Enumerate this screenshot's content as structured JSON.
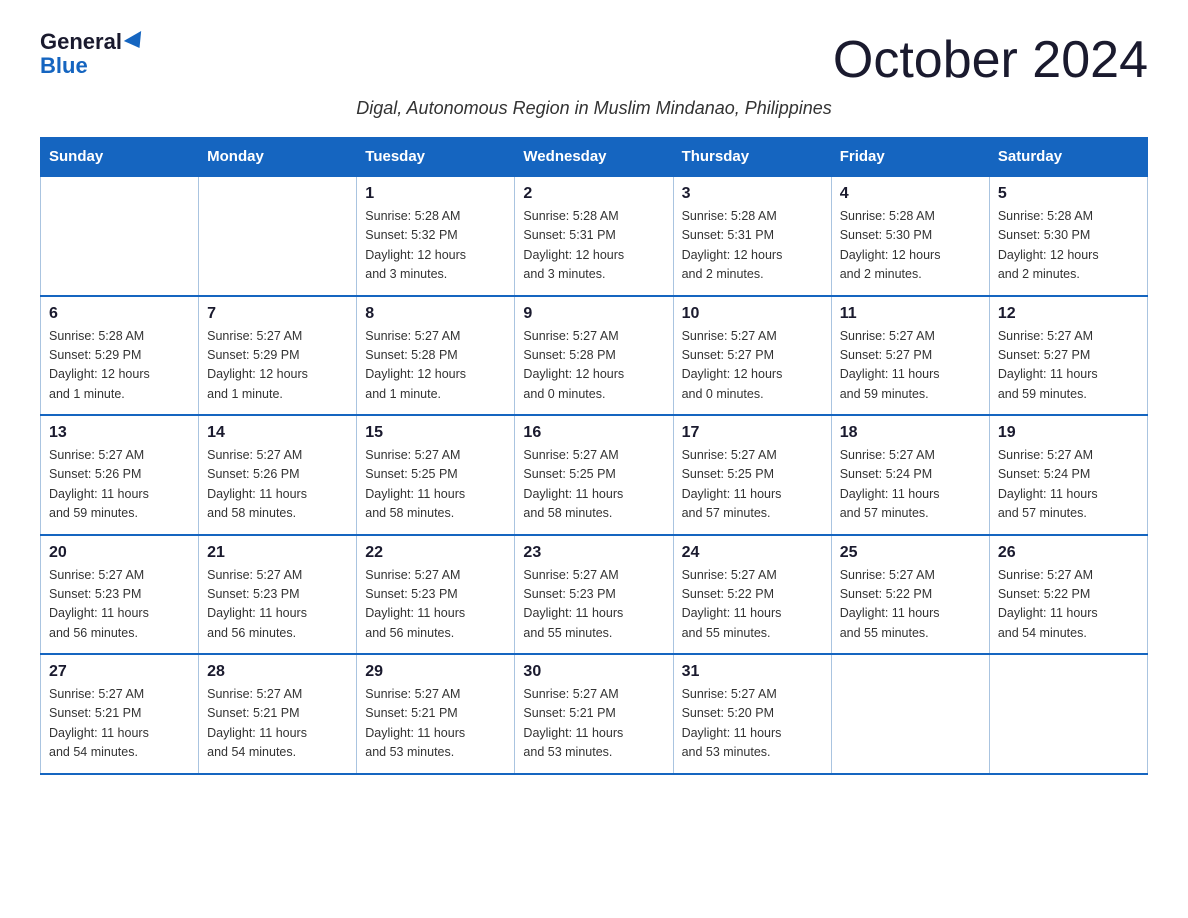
{
  "header": {
    "logo_general": "General",
    "logo_blue": "Blue",
    "month_title": "October 2024",
    "location": "Digal, Autonomous Region in Muslim Mindanao, Philippines"
  },
  "weekdays": [
    "Sunday",
    "Monday",
    "Tuesday",
    "Wednesday",
    "Thursday",
    "Friday",
    "Saturday"
  ],
  "weeks": [
    [
      {
        "day": "",
        "info": ""
      },
      {
        "day": "",
        "info": ""
      },
      {
        "day": "1",
        "info": "Sunrise: 5:28 AM\nSunset: 5:32 PM\nDaylight: 12 hours\nand 3 minutes."
      },
      {
        "day": "2",
        "info": "Sunrise: 5:28 AM\nSunset: 5:31 PM\nDaylight: 12 hours\nand 3 minutes."
      },
      {
        "day": "3",
        "info": "Sunrise: 5:28 AM\nSunset: 5:31 PM\nDaylight: 12 hours\nand 2 minutes."
      },
      {
        "day": "4",
        "info": "Sunrise: 5:28 AM\nSunset: 5:30 PM\nDaylight: 12 hours\nand 2 minutes."
      },
      {
        "day": "5",
        "info": "Sunrise: 5:28 AM\nSunset: 5:30 PM\nDaylight: 12 hours\nand 2 minutes."
      }
    ],
    [
      {
        "day": "6",
        "info": "Sunrise: 5:28 AM\nSunset: 5:29 PM\nDaylight: 12 hours\nand 1 minute."
      },
      {
        "day": "7",
        "info": "Sunrise: 5:27 AM\nSunset: 5:29 PM\nDaylight: 12 hours\nand 1 minute."
      },
      {
        "day": "8",
        "info": "Sunrise: 5:27 AM\nSunset: 5:28 PM\nDaylight: 12 hours\nand 1 minute."
      },
      {
        "day": "9",
        "info": "Sunrise: 5:27 AM\nSunset: 5:28 PM\nDaylight: 12 hours\nand 0 minutes."
      },
      {
        "day": "10",
        "info": "Sunrise: 5:27 AM\nSunset: 5:27 PM\nDaylight: 12 hours\nand 0 minutes."
      },
      {
        "day": "11",
        "info": "Sunrise: 5:27 AM\nSunset: 5:27 PM\nDaylight: 11 hours\nand 59 minutes."
      },
      {
        "day": "12",
        "info": "Sunrise: 5:27 AM\nSunset: 5:27 PM\nDaylight: 11 hours\nand 59 minutes."
      }
    ],
    [
      {
        "day": "13",
        "info": "Sunrise: 5:27 AM\nSunset: 5:26 PM\nDaylight: 11 hours\nand 59 minutes."
      },
      {
        "day": "14",
        "info": "Sunrise: 5:27 AM\nSunset: 5:26 PM\nDaylight: 11 hours\nand 58 minutes."
      },
      {
        "day": "15",
        "info": "Sunrise: 5:27 AM\nSunset: 5:25 PM\nDaylight: 11 hours\nand 58 minutes."
      },
      {
        "day": "16",
        "info": "Sunrise: 5:27 AM\nSunset: 5:25 PM\nDaylight: 11 hours\nand 58 minutes."
      },
      {
        "day": "17",
        "info": "Sunrise: 5:27 AM\nSunset: 5:25 PM\nDaylight: 11 hours\nand 57 minutes."
      },
      {
        "day": "18",
        "info": "Sunrise: 5:27 AM\nSunset: 5:24 PM\nDaylight: 11 hours\nand 57 minutes."
      },
      {
        "day": "19",
        "info": "Sunrise: 5:27 AM\nSunset: 5:24 PM\nDaylight: 11 hours\nand 57 minutes."
      }
    ],
    [
      {
        "day": "20",
        "info": "Sunrise: 5:27 AM\nSunset: 5:23 PM\nDaylight: 11 hours\nand 56 minutes."
      },
      {
        "day": "21",
        "info": "Sunrise: 5:27 AM\nSunset: 5:23 PM\nDaylight: 11 hours\nand 56 minutes."
      },
      {
        "day": "22",
        "info": "Sunrise: 5:27 AM\nSunset: 5:23 PM\nDaylight: 11 hours\nand 56 minutes."
      },
      {
        "day": "23",
        "info": "Sunrise: 5:27 AM\nSunset: 5:23 PM\nDaylight: 11 hours\nand 55 minutes."
      },
      {
        "day": "24",
        "info": "Sunrise: 5:27 AM\nSunset: 5:22 PM\nDaylight: 11 hours\nand 55 minutes."
      },
      {
        "day": "25",
        "info": "Sunrise: 5:27 AM\nSunset: 5:22 PM\nDaylight: 11 hours\nand 55 minutes."
      },
      {
        "day": "26",
        "info": "Sunrise: 5:27 AM\nSunset: 5:22 PM\nDaylight: 11 hours\nand 54 minutes."
      }
    ],
    [
      {
        "day": "27",
        "info": "Sunrise: 5:27 AM\nSunset: 5:21 PM\nDaylight: 11 hours\nand 54 minutes."
      },
      {
        "day": "28",
        "info": "Sunrise: 5:27 AM\nSunset: 5:21 PM\nDaylight: 11 hours\nand 54 minutes."
      },
      {
        "day": "29",
        "info": "Sunrise: 5:27 AM\nSunset: 5:21 PM\nDaylight: 11 hours\nand 53 minutes."
      },
      {
        "day": "30",
        "info": "Sunrise: 5:27 AM\nSunset: 5:21 PM\nDaylight: 11 hours\nand 53 minutes."
      },
      {
        "day": "31",
        "info": "Sunrise: 5:27 AM\nSunset: 5:20 PM\nDaylight: 11 hours\nand 53 minutes."
      },
      {
        "day": "",
        "info": ""
      },
      {
        "day": "",
        "info": ""
      }
    ]
  ]
}
